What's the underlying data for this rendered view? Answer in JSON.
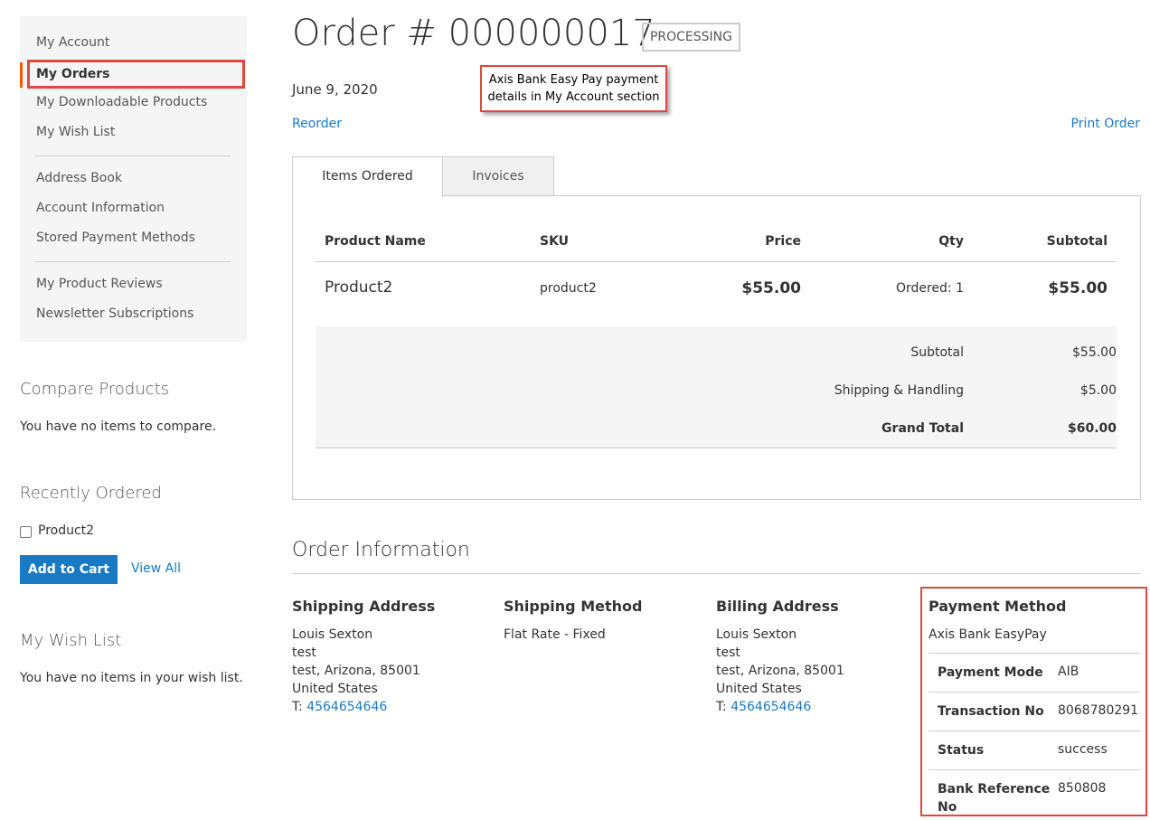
{
  "sidebar": {
    "items": [
      {
        "label": "My Account"
      },
      {
        "label": "My Orders"
      },
      {
        "label": "My Downloadable Products"
      },
      {
        "label": "My Wish List"
      },
      {
        "label": "Address Book"
      },
      {
        "label": "Account Information"
      },
      {
        "label": "Stored Payment Methods"
      },
      {
        "label": "My Product Reviews"
      },
      {
        "label": "Newsletter Subscriptions"
      }
    ],
    "active_index": 1,
    "active_color": "#ff5501"
  },
  "compare": {
    "title": "Compare Products",
    "empty_text": "You have no items to compare."
  },
  "recently_ordered": {
    "title": "Recently Ordered",
    "product": "Product2",
    "add_to_cart": "Add to Cart",
    "view_all": "View All"
  },
  "wishlist": {
    "title": "My Wish List",
    "empty_text": "You have no items in your wish list."
  },
  "order": {
    "title": "Order # 000000017",
    "status": "PROCESSING",
    "date": "June 9, 2020",
    "reorder": "Reorder",
    "print": "Print Order"
  },
  "annotation": {
    "line1": "Axis Bank Easy Pay payment",
    "line2": "details in My Account section",
    "color": "#e0473e"
  },
  "tabs": [
    {
      "label": "Items Ordered"
    },
    {
      "label": "Invoices"
    }
  ],
  "items_table": {
    "headers": {
      "name": "Product Name",
      "sku": "SKU",
      "price": "Price",
      "qty": "Qty",
      "subtotal": "Subtotal"
    },
    "rows": [
      {
        "name": "Product2",
        "sku": "product2",
        "price": "$55.00",
        "qty": "Ordered: 1",
        "subtotal": "$55.00"
      }
    ]
  },
  "totals": [
    {
      "label": "Subtotal",
      "value": "$55.00"
    },
    {
      "label": "Shipping & Handling",
      "value": "$5.00"
    },
    {
      "label": "Grand Total",
      "value": "$60.00"
    }
  ],
  "order_info": {
    "title": "Order Information",
    "shipping_address": {
      "title": "Shipping Address",
      "name": "Louis Sexton",
      "street": "test",
      "city": "test, Arizona, 85001",
      "country": "United States",
      "phone_prefix": "T: ",
      "phone": "4564654646"
    },
    "shipping_method": {
      "title": "Shipping Method",
      "value": "Flat Rate - Fixed"
    },
    "billing_address": {
      "title": "Billing Address",
      "name": "Louis Sexton",
      "street": "test",
      "city": "test, Arizona, 85001",
      "country": "United States",
      "phone_prefix": "T: ",
      "phone": "4564654646"
    },
    "payment_method": {
      "title": "Payment Method",
      "name": "Axis Bank EasyPay",
      "rows": [
        {
          "label": "Payment Mode",
          "value": "AIB"
        },
        {
          "label": "Transaction No",
          "value": "8068780291"
        },
        {
          "label": "Status",
          "value": "success"
        },
        {
          "label_line1": "Bank Reference",
          "label_line2": "No",
          "value": "850808"
        }
      ]
    }
  },
  "colors": {
    "link": "#1979c3",
    "button": "#1979c3",
    "highlight": "#e0473e"
  }
}
